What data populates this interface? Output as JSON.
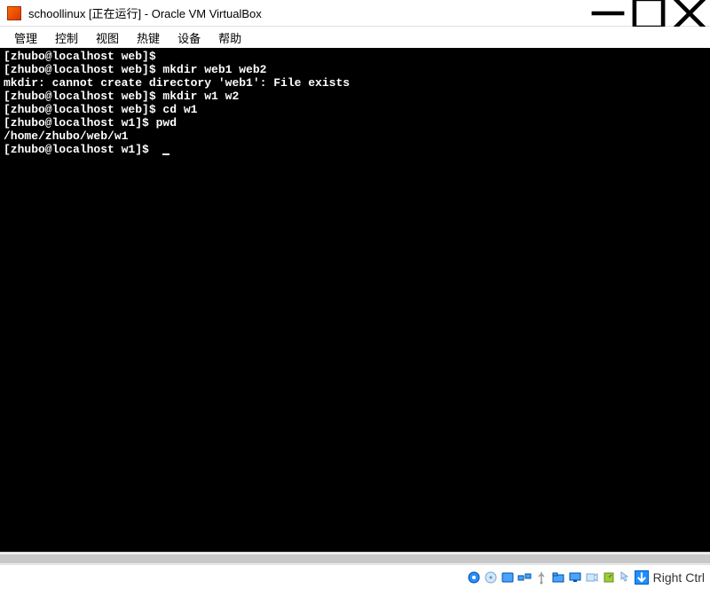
{
  "titlebar": {
    "title": "schoollinux [正在运行] - Oracle VM VirtualBox"
  },
  "menubar": {
    "items": [
      "管理",
      "控制",
      "视图",
      "热键",
      "设备",
      "帮助"
    ]
  },
  "terminal": {
    "lines": [
      {
        "prompt": "[zhubo@localhost web]$ ",
        "cmd": ""
      },
      {
        "prompt": "[zhubo@localhost web]$ ",
        "cmd": "mkdir web1 web2"
      },
      {
        "prompt": "",
        "cmd": "mkdir: cannot create directory 'web1': File exists"
      },
      {
        "prompt": "[zhubo@localhost web]$ ",
        "cmd": "mkdir w1 w2"
      },
      {
        "prompt": "[zhubo@localhost web]$ ",
        "cmd": "cd w1"
      },
      {
        "prompt": "[zhubo@localhost w1]$ ",
        "cmd": "pwd"
      },
      {
        "prompt": "",
        "cmd": "/home/zhubo/web/w1"
      },
      {
        "prompt": "[zhubo@localhost w1]$ ",
        "cmd": "",
        "cursor": true
      }
    ]
  },
  "statusbar": {
    "hostkey": "Right Ctrl"
  }
}
